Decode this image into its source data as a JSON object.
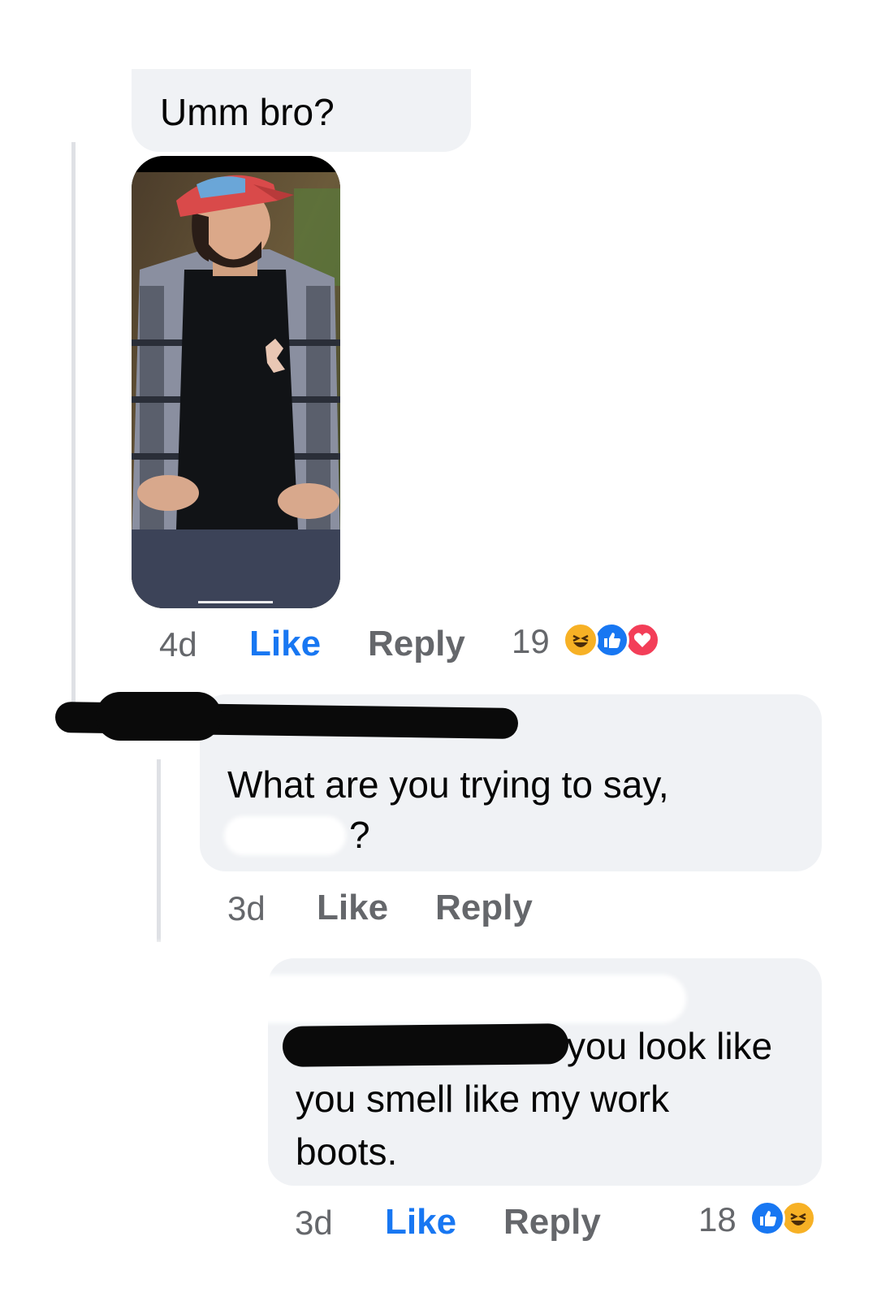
{
  "comments": [
    {
      "text": "Umm bro?",
      "time": "4d",
      "like_label": "Like",
      "reply_label": "Reply",
      "reaction_count": "19",
      "reactions": [
        "haha-icon",
        "like-icon",
        "love-icon"
      ]
    },
    {
      "text_line1": "What are you trying to say,",
      "text_line2": "?",
      "time": "3d",
      "like_label": "Like",
      "reply_label": "Reply"
    },
    {
      "text_line1": "you look like",
      "text_line2": "you smell like my work",
      "text_line3": "boots.",
      "time": "3d",
      "like_label": "Like",
      "reply_label": "Reply",
      "reaction_count": "18",
      "reactions": [
        "like-icon",
        "haha-icon"
      ]
    }
  ],
  "colors": {
    "bubble": "#f0f2f5",
    "like_active": "#1877f2",
    "meta_gray": "#65676b",
    "love_red": "#f33e58",
    "haha_yellow": "#f7b125"
  }
}
